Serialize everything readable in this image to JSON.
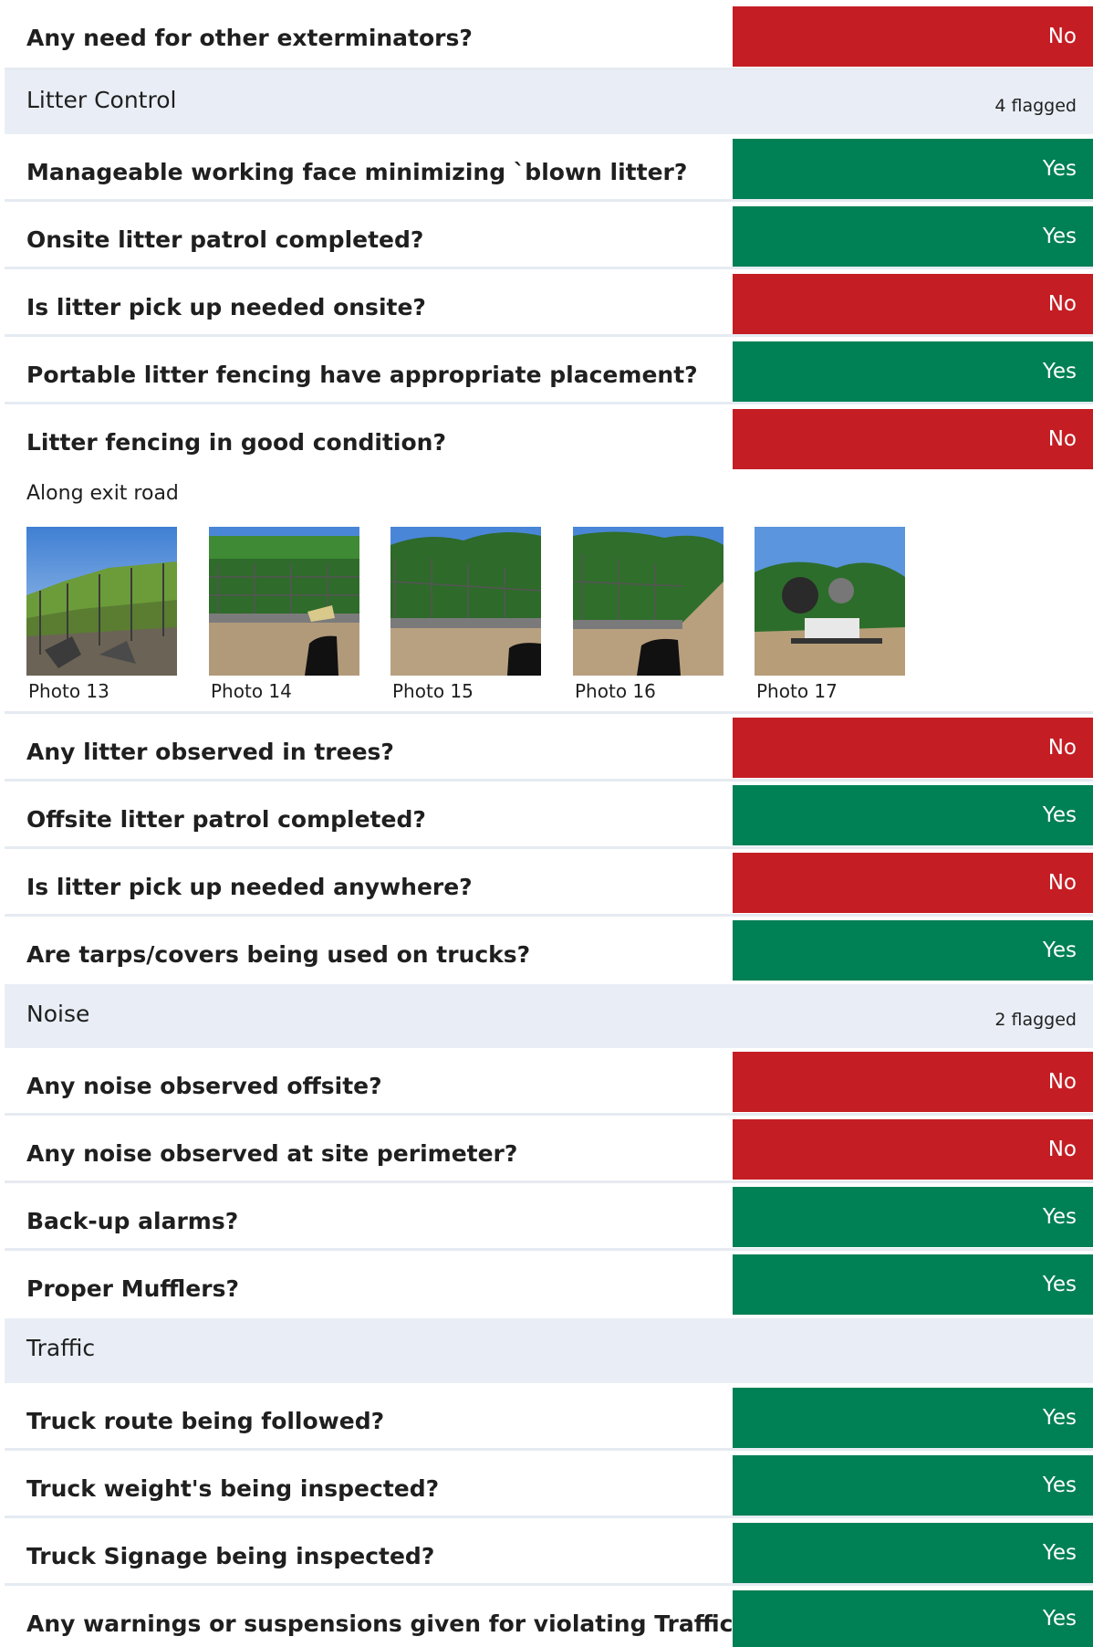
{
  "top_item": {
    "question": "Any need for other exterminators?",
    "answer": "No"
  },
  "sections": [
    {
      "title": "Litter Control",
      "flagged": "4 flagged",
      "items_a": [
        {
          "question": "Manageable working face minimizing `blown litter?",
          "answer": "Yes"
        },
        {
          "question": "Onsite litter patrol completed?",
          "answer": "Yes"
        },
        {
          "question": "Is litter pick up needed onsite?",
          "answer": "No"
        },
        {
          "question": "Portable litter fencing have appropriate placement?",
          "answer": "Yes"
        },
        {
          "question": "Litter fencing in good condition?",
          "answer": "No"
        }
      ],
      "note": "Along exit road",
      "photos": [
        "Photo 13",
        "Photo 14",
        "Photo 15",
        "Photo 16",
        "Photo 17"
      ],
      "items_b": [
        {
          "question": "Any litter observed in trees?",
          "answer": "No"
        },
        {
          "question": "Offsite litter patrol completed?",
          "answer": "Yes"
        },
        {
          "question": "Is litter pick up needed anywhere?",
          "answer": "No"
        },
        {
          "question": "Are tarps/covers being used on trucks?",
          "answer": "Yes"
        }
      ]
    },
    {
      "title": "Noise",
      "flagged": "2 flagged",
      "items": [
        {
          "question": "Any noise observed offsite?",
          "answer": "No"
        },
        {
          "question": "Any noise observed at site perimeter?",
          "answer": "No"
        },
        {
          "question": "Back-up alarms?",
          "answer": "Yes"
        },
        {
          "question": "Proper Mufflers?",
          "answer": "Yes"
        }
      ]
    },
    {
      "title": "Traffic",
      "items": [
        {
          "question": "Truck route being followed?",
          "answer": "Yes"
        },
        {
          "question": "Truck weight's being inspected?",
          "answer": "Yes"
        },
        {
          "question": "Truck Signage being inspected?",
          "answer": "Yes"
        },
        {
          "question": "Any warnings or suspensions given for violating Traffic",
          "answer": "Yes"
        }
      ]
    }
  ],
  "colors": {
    "no": "#c41e24",
    "yes": "#008055",
    "section_bg": "#e9eef6"
  }
}
